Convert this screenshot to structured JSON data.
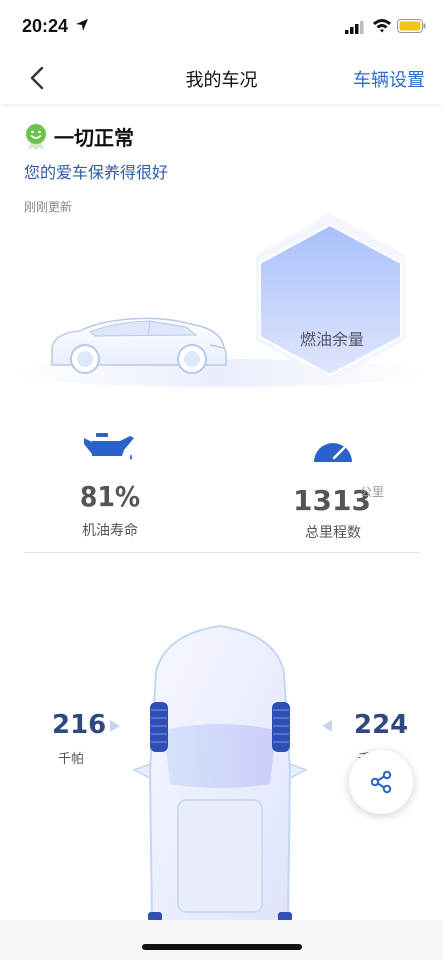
{
  "status_bar": {
    "time": "20:24"
  },
  "nav": {
    "title": "我的车况",
    "action": "车辆设置"
  },
  "summary": {
    "title": "一切正常",
    "subtitle": "您的爱车保养得很好",
    "updated": "刚刚更新"
  },
  "fuel": {
    "label": "燃油余量"
  },
  "oil": {
    "value": "81%",
    "label": "机油寿命"
  },
  "odometer": {
    "value": "1313",
    "unit": "公里",
    "label": "总里程数"
  },
  "tires": {
    "left": {
      "value": "216",
      "unit": "千帕"
    },
    "right": {
      "value": "224",
      "unit": "千帕"
    }
  },
  "colors": {
    "accent": "#2b6cd0",
    "tire_value": "#2c4a7e",
    "ok_green": "#6cc24a"
  }
}
